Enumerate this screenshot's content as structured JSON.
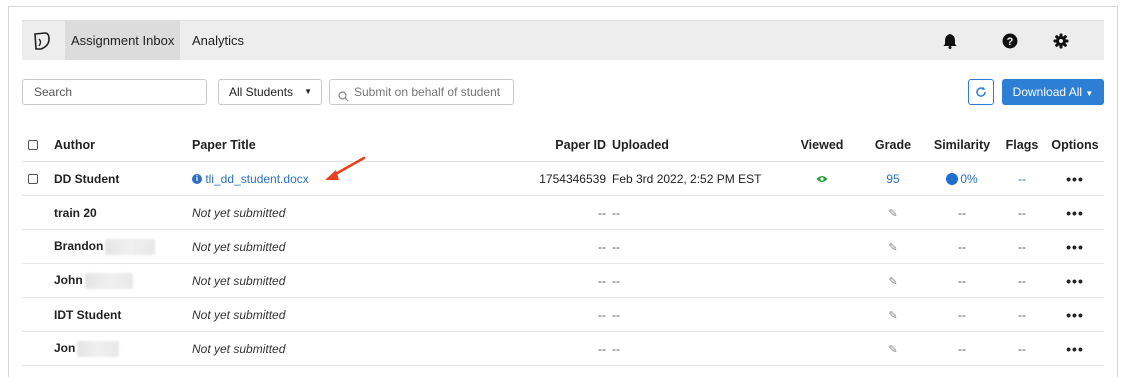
{
  "nav": {
    "tabs": [
      {
        "label": "Assignment Inbox",
        "active": true
      },
      {
        "label": "Analytics",
        "active": false
      }
    ],
    "icons": [
      "bell-icon",
      "help-icon",
      "gear-icon"
    ]
  },
  "toolbar": {
    "search_placeholder": "Search",
    "filter_value": "All Students",
    "submit_placeholder": "Submit on behalf of student",
    "download_label": "Download All"
  },
  "table": {
    "headers": {
      "author": "Author",
      "title": "Paper Title",
      "paper_id": "Paper ID",
      "uploaded": "Uploaded",
      "viewed": "Viewed",
      "grade": "Grade",
      "similarity": "Similarity",
      "flags": "Flags",
      "options": "Options"
    },
    "rows": [
      {
        "author": "DD Student",
        "title": "tli_dd_student.docx",
        "paper_id": "1754346539",
        "uploaded": "Feb 3rd 2022, 2:52 PM EST",
        "grade": "95",
        "similarity": "0%",
        "flags": "--",
        "options": "•••"
      },
      {
        "author": "train 20",
        "title": "Not yet submitted",
        "paper_id": "--",
        "uploaded": "--",
        "similarity": "--",
        "flags": "--",
        "options": "•••"
      },
      {
        "author": "Brandon",
        "title": "Not yet submitted",
        "paper_id": "--",
        "uploaded": "--",
        "similarity": "--",
        "flags": "--",
        "options": "•••"
      },
      {
        "author": "John",
        "title": "Not yet submitted",
        "paper_id": "--",
        "uploaded": "--",
        "similarity": "--",
        "flags": "--",
        "options": "•••"
      },
      {
        "author": "IDT Student",
        "title": "Not yet submitted",
        "paper_id": "--",
        "uploaded": "--",
        "similarity": "--",
        "flags": "--",
        "options": "•••"
      },
      {
        "author": "Jon",
        "title": "Not yet submitted",
        "paper_id": "--",
        "uploaded": "--",
        "similarity": "--",
        "flags": "--",
        "options": "•••"
      }
    ]
  },
  "colors": {
    "accent": "#2d7fd6",
    "link": "#2d6fc0",
    "viewed_icon": "#2a9d3a",
    "similarity_dot": "#1e6fd0",
    "annotation_arrow": "#e8401c"
  }
}
